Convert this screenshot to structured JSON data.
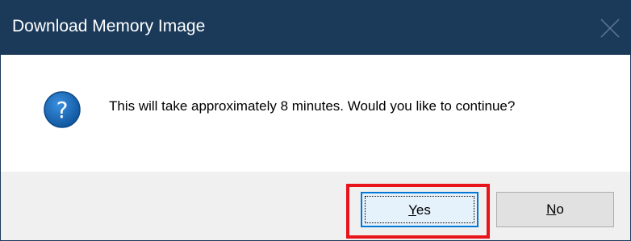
{
  "dialog": {
    "title": "Download Memory Image",
    "close_icon": "close-icon",
    "icon": "question-icon",
    "message": "This will take approximately 8 minutes.  Would you like to continue?",
    "buttons": {
      "yes": {
        "accel": "Y",
        "rest": "es"
      },
      "no": {
        "accel": "N",
        "rest": "o"
      }
    }
  },
  "colors": {
    "titlebar": "#1b3a5a",
    "icon_blue": "#1a6fc4",
    "highlight": "#e8131b",
    "focus_border": "#0078d7"
  }
}
